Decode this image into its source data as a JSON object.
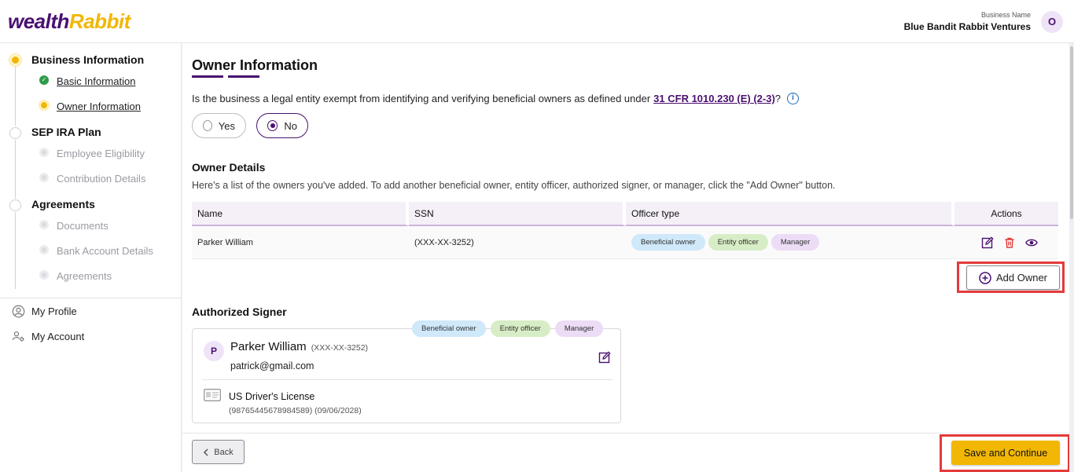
{
  "header": {
    "logo_part1": "wealth",
    "logo_part2": "Rabbit",
    "business_label": "Business Name",
    "business_name": "Blue Bandit Rabbit Ventures",
    "avatar_initial": "O"
  },
  "sidebar": {
    "steps": [
      {
        "title": "Business Information",
        "items": [
          "Basic Information",
          "Owner Information"
        ]
      },
      {
        "title": "SEP IRA Plan",
        "items": [
          "Employee Eligibility",
          "Contribution Details"
        ]
      },
      {
        "title": "Agreements",
        "items": [
          "Documents",
          "Bank Account Details",
          "Agreements"
        ]
      }
    ],
    "links": [
      "My Profile",
      "My Account"
    ]
  },
  "main": {
    "title": "Owner Information",
    "question_text": "Is the business a legal entity exempt from identifying and verifying beneficial owners as defined under",
    "question_link": "31 CFR 1010.230 (E) (2-3)",
    "question_mark": "?",
    "radio_yes": "Yes",
    "radio_no": "No",
    "owner_details_title": "Owner Details",
    "owner_details_desc": "Here's a list of the owners you've added. To add another beneficial owner, entity officer, authorized signer, or manager, click the \"Add Owner\" button.",
    "table": {
      "headers": [
        "Name",
        "SSN",
        "Officer type",
        "Actions"
      ],
      "rows": [
        {
          "name": "Parker William",
          "ssn": "(XXX-XX-3252)",
          "types": [
            "Beneficial owner",
            "Entity officer",
            "Manager"
          ]
        }
      ]
    },
    "add_owner_label": "Add Owner",
    "authorized_signer_title": "Authorized Signer",
    "signer": {
      "initial": "P",
      "name": "Parker William",
      "ssn": "(XXX-XX-3252)",
      "email": "patrick@gmail.com",
      "badges": [
        "Beneficial owner",
        "Entity officer",
        "Manager"
      ],
      "id_type": "US Driver's License",
      "id_number": "(98765445678984589) (09/06/2028)"
    }
  },
  "footer": {
    "back_label": "Back",
    "save_label": "Save and Continue"
  },
  "colors": {
    "brand_purple": "#4a1070",
    "brand_yellow": "#f2b705",
    "highlight_red": "#e53a3a",
    "success_green": "#2e9b4a"
  }
}
